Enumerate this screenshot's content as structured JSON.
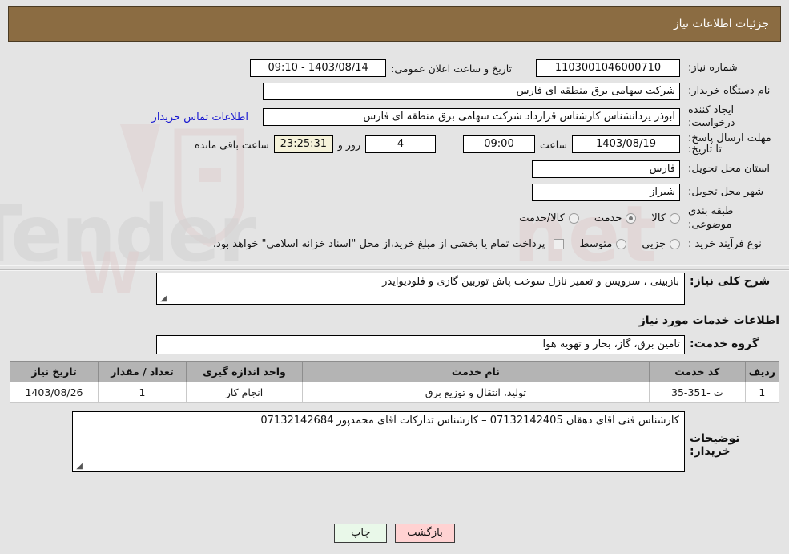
{
  "header": {
    "title": "جزئیات اطلاعات نیاز"
  },
  "fields": {
    "need_number_label": "شماره نیاز:",
    "need_number_value": "1103001046000710",
    "announce_label": "تاریخ و ساعت اعلان عمومی:",
    "announce_value": "1403/08/14 - 09:10",
    "buyer_org_label": "نام دستگاه خریدار:",
    "buyer_org_value": "شرکت سهامی برق منطقه ای فارس",
    "creator_label": "ایجاد کننده درخواست:",
    "creator_value": "ابوذر  یزدانشناس کارشناس قرارداد شرکت سهامی برق منطقه ای فارس",
    "contact_link": "اطلاعات تماس خریدار",
    "deadline_label": "مهلت ارسال پاسخ: تا تاریخ:",
    "deadline_date": "1403/08/19",
    "hour_label": "ساعت",
    "deadline_time": "09:00",
    "days_left": "4",
    "days_sep": "روز و",
    "time_left": "23:25:31",
    "time_left_suffix": "ساعت باقی مانده",
    "province_label": "استان محل تحویل:",
    "province_value": "فارس",
    "city_label": "شهر محل تحویل:",
    "city_value": "شیراز",
    "category_label": "طبقه بندی موضوعی:",
    "process_label": "نوع فرآیند خرید :",
    "treasury_note": "پرداخت تمام یا بخشی از مبلغ خرید،از محل \"اسناد خزانه اسلامی\" خواهد بود."
  },
  "category_options": [
    {
      "label": "کالا",
      "selected": false
    },
    {
      "label": "خدمت",
      "selected": true
    },
    {
      "label": "کالا/خدمت",
      "selected": false
    }
  ],
  "process_options": [
    {
      "label": "جزیی",
      "selected": false
    },
    {
      "label": "متوسط",
      "selected": false
    }
  ],
  "summary": {
    "label": "شرح کلی نیاز:",
    "value": "بازبینی ، سرویس و تعمیر نازل سوخت پاش توربین گازی و فلودیوایدر"
  },
  "services_heading": "اطلاعات خدمات مورد نیاز",
  "service_group": {
    "label": "گروه خدمت:",
    "value": "تامین برق، گاز، بخار و تهویه هوا"
  },
  "table": {
    "columns": [
      "ردیف",
      "کد خدمت",
      "نام خدمت",
      "واحد اندازه گیری",
      "تعداد / مقدار",
      "تاریخ نیاز"
    ],
    "rows": [
      {
        "row_no": "1",
        "service_code": "ت -351-35",
        "service_name": "تولید، انتقال و توزیع برق",
        "unit": "انجام کار",
        "quantity": "1",
        "need_date": "1403/08/26"
      }
    ]
  },
  "buyer_notes": {
    "label": "توضیحات خریدار:",
    "value": "کارشناس فنی آقای دهقان 07132142405 – کارشناس تدارکات آقای محمدپور 07132142684"
  },
  "buttons": {
    "print": "چاپ",
    "back": "بازگشت"
  },
  "watermark": {
    "text": "AriaTender.net"
  },
  "colors": {
    "header_bg": "#8b6c42",
    "link": "#1414d0",
    "table_header_bg": "#b4b4b4",
    "print_btn_bg": "#e9f8e9",
    "back_btn_bg": "#ffd2d2",
    "page_bg": "#e4e4e4"
  }
}
